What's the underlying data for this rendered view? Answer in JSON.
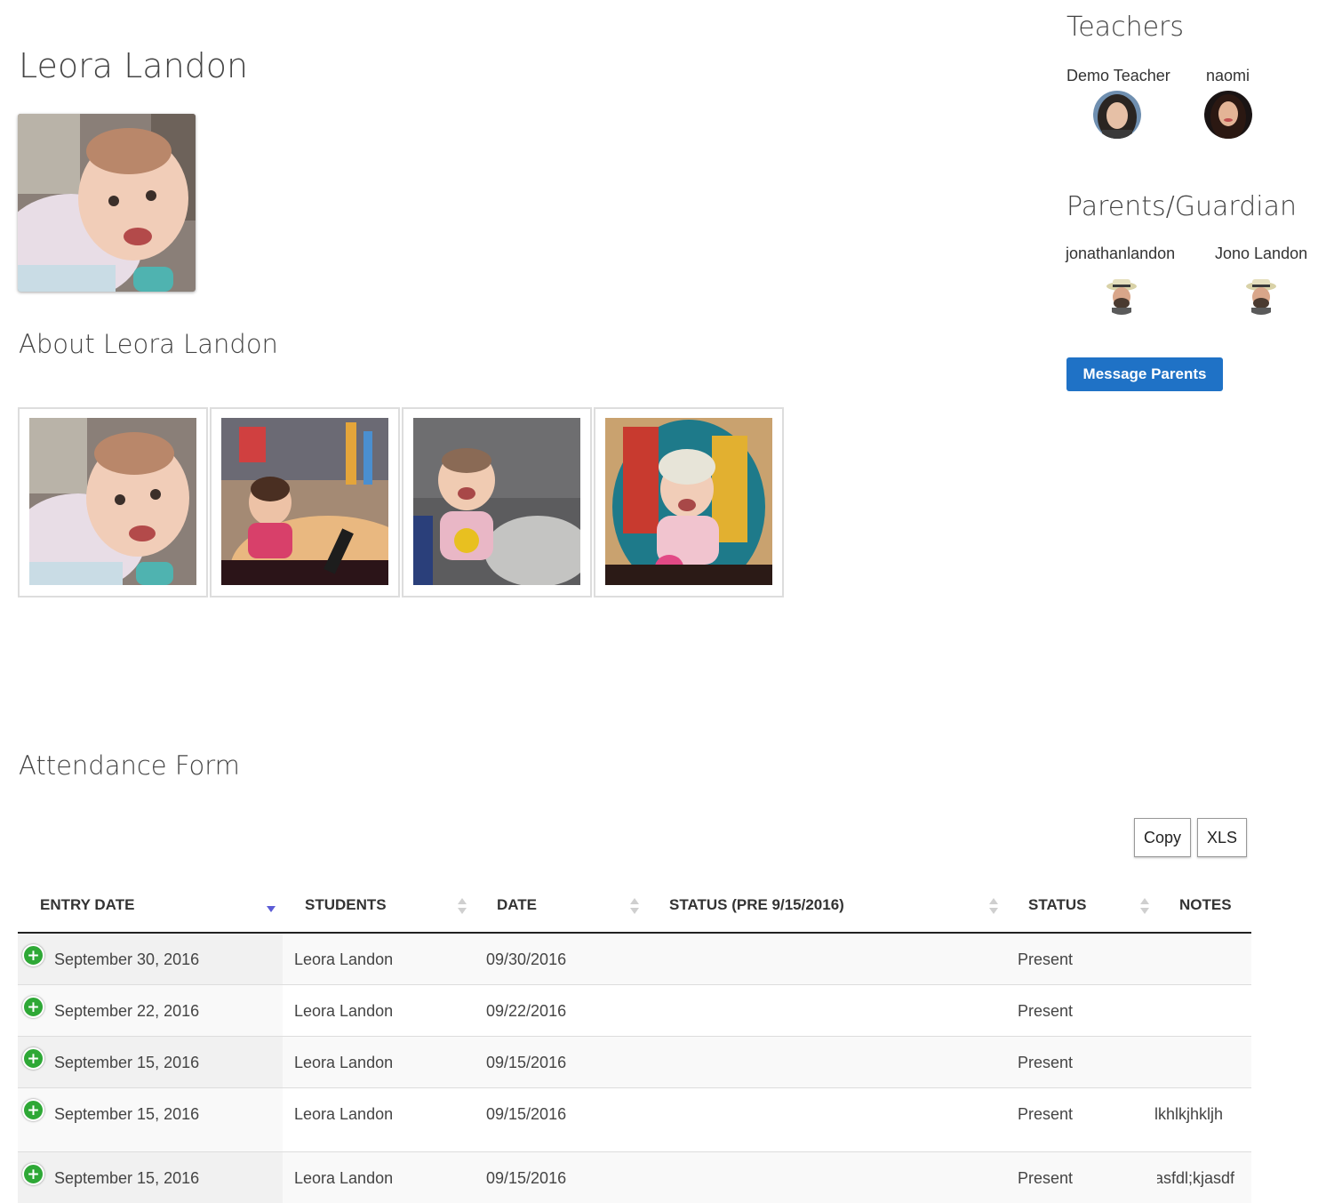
{
  "student": {
    "name": "Leora Landon",
    "about_title": "About Leora Landon"
  },
  "gallery": {
    "photos": [
      "baby-photo-1",
      "baby-photo-2",
      "baby-photo-3",
      "baby-photo-4"
    ]
  },
  "attendance": {
    "title": "Attendance Form",
    "copy_label": "Copy",
    "xls_label": "XLS",
    "columns": [
      "ENTRY DATE",
      "STUDENTS",
      "DATE",
      "STATUS (PRE 9/15/2016)",
      "STATUS",
      "NOTES"
    ],
    "rows": [
      {
        "entry_date": "September 30, 2016",
        "student": "Leora Landon",
        "date": "09/30/2016",
        "status_pre": "",
        "status": "Present",
        "notes": ""
      },
      {
        "entry_date": "September 22, 2016",
        "student": "Leora Landon",
        "date": "09/22/2016",
        "status_pre": "",
        "status": "Present",
        "notes": ""
      },
      {
        "entry_date": "September 15, 2016",
        "student": "Leora Landon",
        "date": "09/15/2016",
        "status_pre": "",
        "status": "Present",
        "notes": ""
      },
      {
        "entry_date": "September 15, 2016",
        "student": "Leora Landon",
        "date": "09/15/2016",
        "status_pre": "",
        "status": "Present",
        "notes": "lkhlkjhkljh"
      },
      {
        "entry_date": "September 15, 2016",
        "student": "Leora Landon",
        "date": "09/15/2016",
        "status_pre": "",
        "status": "Present",
        "notes": "asfdl;kjasdf"
      }
    ]
  },
  "teachers": {
    "title": "Teachers",
    "people": [
      {
        "name": "Demo Teacher"
      },
      {
        "name": "naomi"
      }
    ]
  },
  "parents": {
    "title": "Parents/Guardian",
    "people": [
      {
        "name": "jonathanlandon"
      },
      {
        "name": "Jono Landon"
      }
    ],
    "message_label": "Message Parents"
  },
  "colors": {
    "primary_button": "#1f72c6",
    "add_icon": "#2ea836",
    "sort_active": "#5b5bd6"
  }
}
